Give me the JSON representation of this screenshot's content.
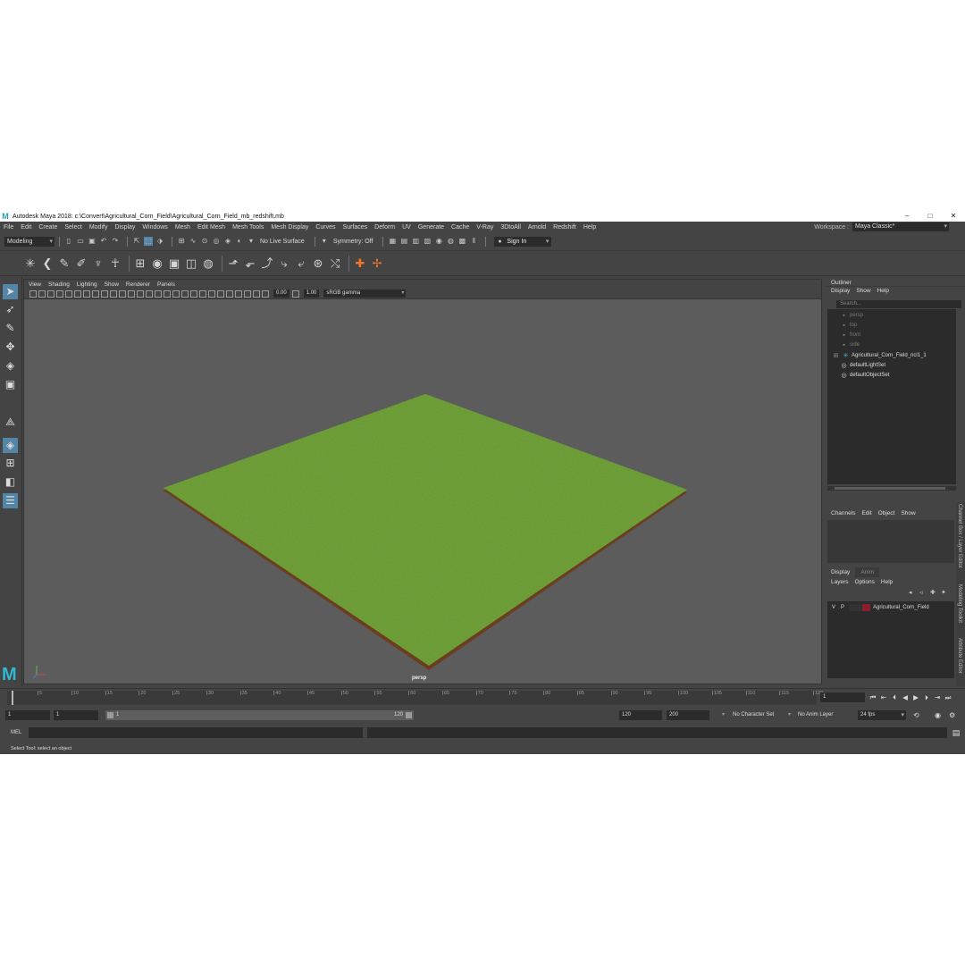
{
  "window": {
    "title": "Autodesk Maya 2018: c:\\Convert\\Agricultural_Corn_Field\\Agricultural_Corn_Field_mb_redshift.mb",
    "logo": "M",
    "minimize": "–",
    "maximize": "□",
    "close": "✕"
  },
  "menubar": {
    "items": [
      "File",
      "Edit",
      "Create",
      "Select",
      "Modify",
      "Display",
      "Windows",
      "Mesh",
      "Edit Mesh",
      "Mesh Tools",
      "Mesh Display",
      "Curves",
      "Surfaces",
      "Deform",
      "UV",
      "Generate",
      "Cache",
      "V-Ray",
      "3DtoAll",
      "Arnold",
      "Redshift",
      "Help"
    ],
    "workspace_label": "Workspace :",
    "workspace_value": "Maya Classic*"
  },
  "statusline": {
    "menu_set": "Modeling",
    "live_surface": "No Live Surface",
    "symmetry": "Symmetry: Off",
    "sign_in": "Sign In"
  },
  "viewport": {
    "menu": [
      "View",
      "Shading",
      "Lighting",
      "Show",
      "Renderer",
      "Panels"
    ],
    "exposure": "0.00",
    "gamma_value": "1.00",
    "color_space": "sRGB gamma",
    "camera_label": "persp",
    "accent": "#5285a6"
  },
  "outliner": {
    "title": "Outliner",
    "menu": [
      "Display",
      "Show",
      "Help"
    ],
    "search_placeholder": "Search...",
    "items": [
      {
        "label": "persp",
        "icon": "camera-icon",
        "dim": true
      },
      {
        "label": "top",
        "icon": "camera-icon",
        "dim": true
      },
      {
        "label": "front",
        "icon": "camera-icon",
        "dim": true
      },
      {
        "label": "side",
        "icon": "camera-icon",
        "dim": true
      },
      {
        "label": "Agricultural_Corn_Field_ncl1_1",
        "icon": "group-icon",
        "dim": false
      },
      {
        "label": "defaultLightSet",
        "icon": "set-icon",
        "dim": false
      },
      {
        "label": "defaultObjectSet",
        "icon": "set-icon",
        "dim": false
      }
    ]
  },
  "channelbox": {
    "menu": [
      "Channels",
      "Edit",
      "Object",
      "Show"
    ]
  },
  "layereditor": {
    "tabs": [
      "Display",
      "Anim"
    ],
    "menu": [
      "Layers",
      "Options",
      "Help"
    ],
    "layer": {
      "v": "V",
      "p": "P",
      "name": "Agricultural_Corn_Field",
      "color": "#8b1e2e"
    }
  },
  "sidetabs": [
    "Channel Box / Layer Editor",
    "Modeling Toolkit",
    "Attribute Editor"
  ],
  "timeslider": {
    "ticks": [
      "5",
      "10",
      "15",
      "20",
      "25",
      "30",
      "35",
      "40",
      "45",
      "50",
      "55",
      "60",
      "65",
      "70",
      "75",
      "80",
      "85",
      "90",
      "95",
      "100",
      "105",
      "110",
      "115",
      "120"
    ],
    "current_frame": "1"
  },
  "rangeslider": {
    "start": "1",
    "playback_start": "1",
    "range_start": "1",
    "range_end": "120",
    "playback_end": "120",
    "end": "200",
    "character_set": "No Character Set",
    "anim_layer": "No Anim Layer",
    "fps": "24 fps"
  },
  "cmdline": {
    "language": "MEL"
  },
  "helpline": {
    "text": "Select Tool: select an object"
  }
}
